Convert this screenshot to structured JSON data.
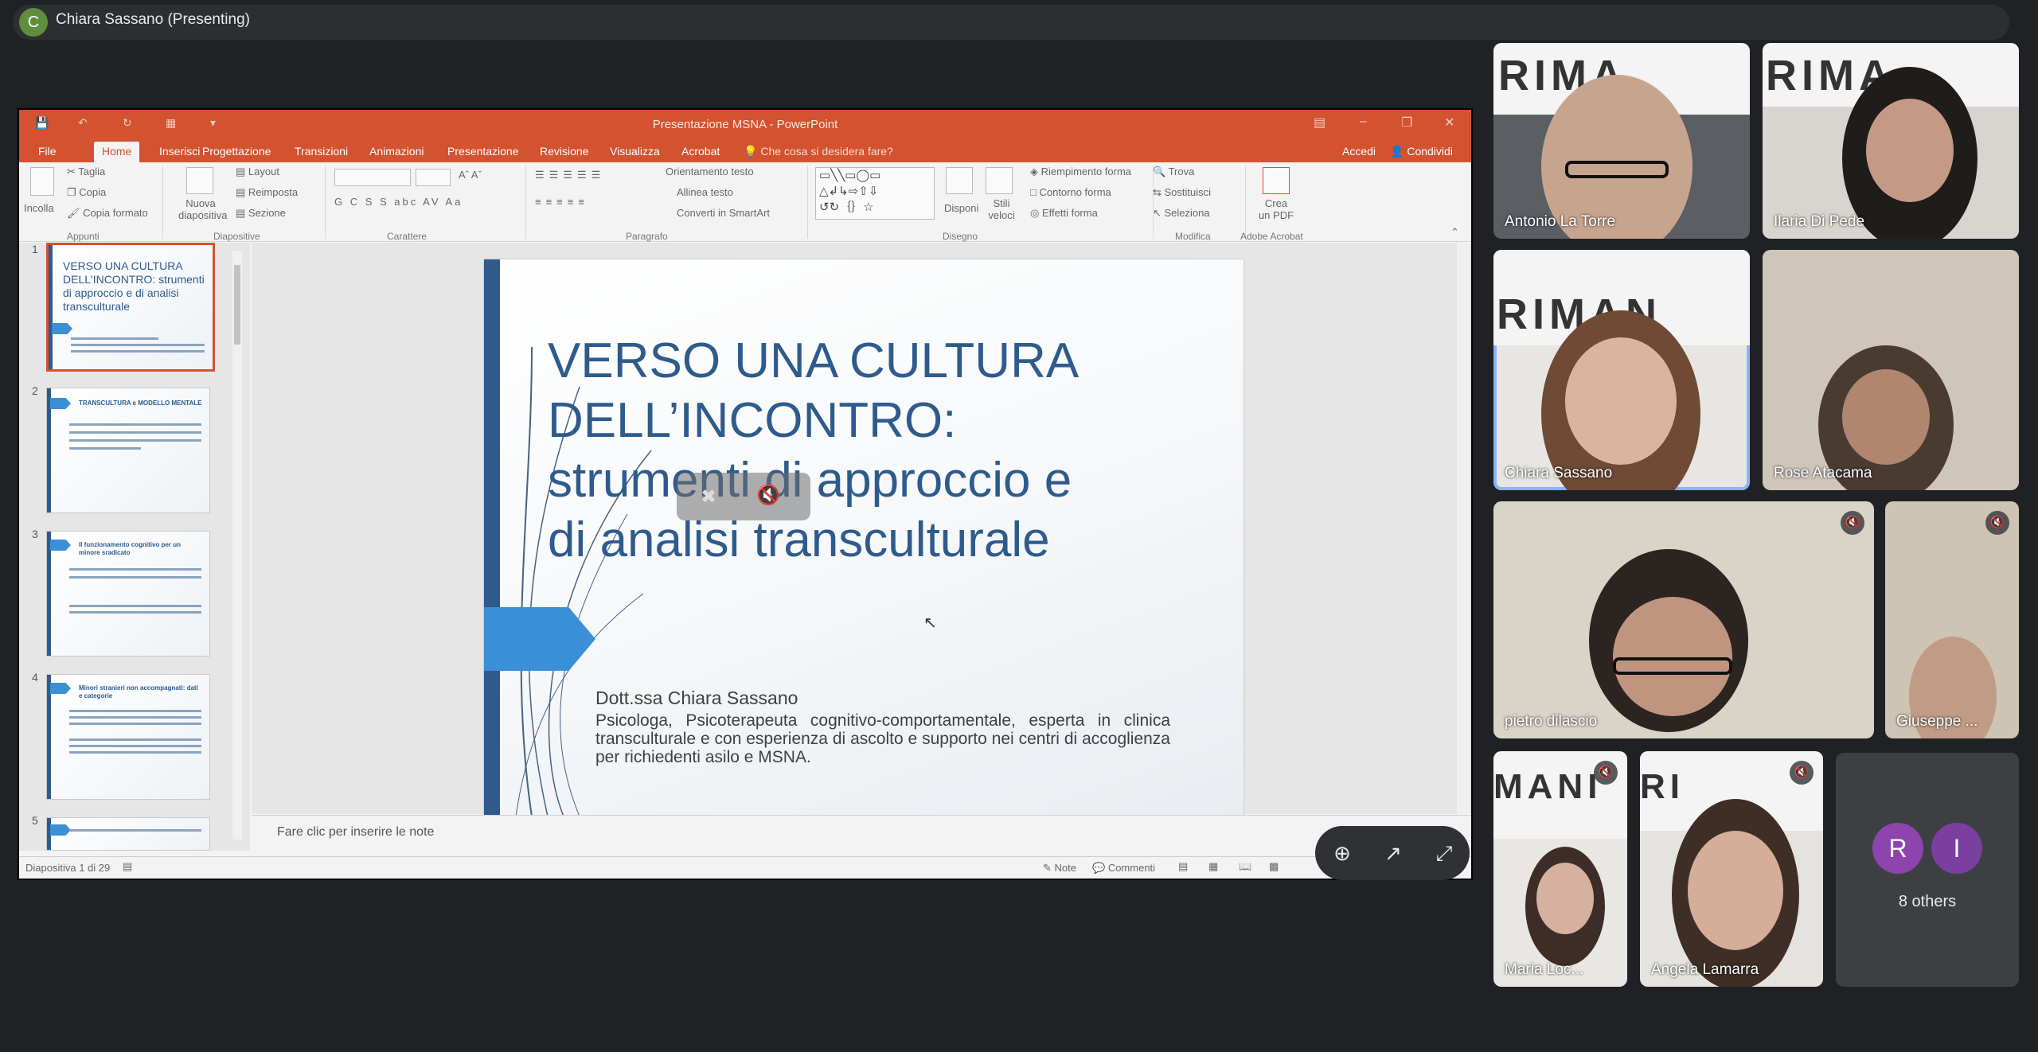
{
  "meeting": {
    "presenter_initial": "C",
    "presenter_label": "Chiara Sassano (Presenting)"
  },
  "ppt": {
    "window_title": "Presentazione MSNA - PowerPoint",
    "tabs": [
      "File",
      "Home",
      "Inserisci",
      "Progettazione",
      "Transizioni",
      "Animazioni",
      "Presentazione",
      "Revisione",
      "Visualizza",
      "Acrobat"
    ],
    "tell_me": "Che cosa si desidera fare?",
    "sign_in": "Accedi",
    "share": "Condividi",
    "ribbon": {
      "paste": "Incolla",
      "cut": "Taglia",
      "copy": "Copia",
      "format_painter": "Copia formato",
      "new_slide": "Nuova diapositiva",
      "layout": "Layout",
      "reset": "Reimposta",
      "section": "Sezione",
      "font_buttons": "G  C  S  S  abc  AV  Aa",
      "text_direction": "Orientamento testo",
      "align_text": "Allinea testo",
      "smartart": "Converti in SmartArt",
      "arrange": "Disponi",
      "quick_styles": "Stili veloci",
      "shape_fill": "Riempimento forma",
      "shape_outline": "Contorno forma",
      "shape_effects": "Effetti forma",
      "find": "Trova",
      "replace": "Sostituisci",
      "select": "Seleziona",
      "create_pdf": "Crea un PDF",
      "groups": [
        "Appunti",
        "Diapositive",
        "Carattere",
        "Paragrafo",
        "Disegno",
        "Modifica",
        "Adobe Acrobat"
      ]
    },
    "thumbnails": [
      {
        "num": "1",
        "title": "VERSO UNA CULTURA DELL'INCONTRO: strumenti di approccio e di analisi transculturale"
      },
      {
        "num": "2",
        "title": "TRANSCULTURA e MODELLO MENTALE"
      },
      {
        "num": "3",
        "title": "Il funzionamento cognitivo per un minore sradicato"
      },
      {
        "num": "4",
        "title": "Minori stranieri non accompagnati: dati e categorie"
      },
      {
        "num": "5",
        "title": ""
      }
    ],
    "slide": {
      "title_line1": "VERSO UNA CULTURA",
      "title_line2": "DELL’INCONTRO:",
      "title_line3": "strumenti di approccio e",
      "title_line4": "di analisi transculturale",
      "author": "Dott.ssa Chiara Sassano",
      "description": "Psicologa, Psicoterapeuta cognitivo-comportamentale, esperta in clinica transculturale e con esperienza di ascolto e supporto nei centri di accoglienza per richiedenti asilo e MSNA."
    },
    "notes_placeholder": "Fare clic per inserire le note",
    "status": {
      "slide_counter": "Diapositiva 1 di 29",
      "notes": "Note",
      "comments": "Commenti"
    }
  },
  "participants": [
    {
      "name": "Antonio La Torre"
    },
    {
      "name": "Ilaria Di Pede"
    },
    {
      "name": "Chiara Sassano"
    },
    {
      "name": "Rose Atacama"
    },
    {
      "name": "pietro dilascio"
    },
    {
      "name": "Giuseppe ..."
    },
    {
      "name": "Maria Loc..."
    },
    {
      "name": "Angela Lamarra"
    }
  ],
  "others": {
    "avatar1": "R",
    "avatar2": "I",
    "label": "8 others"
  },
  "colors": {
    "ppt_accent": "#d35230",
    "slide_blue": "#2e5b8c",
    "arrow_blue": "#3b8fd6",
    "meet_bg": "#202124",
    "active_speaker": "#8ab4f8"
  }
}
